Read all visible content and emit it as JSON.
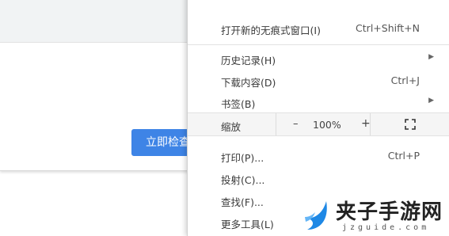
{
  "background": {
    "button_label": "立即检查",
    "accent_color": "#3e84e6"
  },
  "menu": {
    "items": [
      {
        "label": "打开新的无痕式窗口(I)",
        "shortcut": "Ctrl+Shift+N"
      },
      {
        "label": "历史记录(H)",
        "shortcut": "",
        "submenu": true
      },
      {
        "label": "下载内容(D)",
        "shortcut": "Ctrl+J"
      },
      {
        "label": "书签(B)",
        "shortcut": "",
        "submenu": true
      },
      {
        "label": "打印(P)...",
        "shortcut": "Ctrl+P"
      },
      {
        "label": "投射(C)...",
        "shortcut": ""
      },
      {
        "label": "查找(F)...",
        "shortcut": ""
      },
      {
        "label": "更多工具(L)",
        "shortcut": "",
        "submenu": true
      }
    ],
    "zoom": {
      "label": "缩放",
      "minus": "–",
      "value": "100%",
      "plus": "+",
      "fullscreen_icon": "fullscreen-icon"
    }
  },
  "watermark": {
    "name": "夹子手游网",
    "domain": "jzguide.com",
    "logo_color": "#1e88e5"
  }
}
